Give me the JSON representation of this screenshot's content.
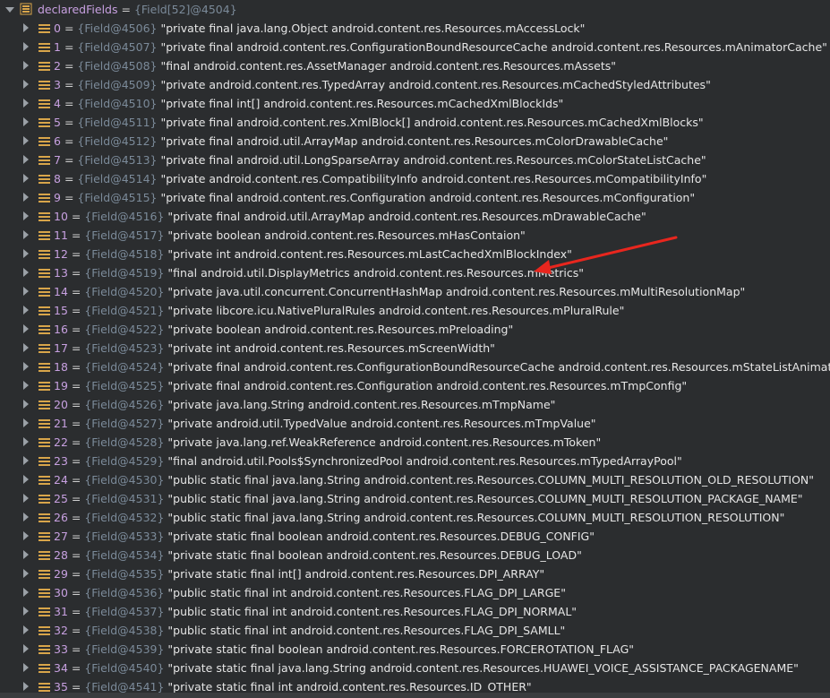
{
  "root": {
    "name": "declaredFields",
    "equals": "=",
    "ref": "{Field[52]@4504}"
  },
  "fields": [
    {
      "idx": "0",
      "ref": "{Field@4506}",
      "value": "\"private final java.lang.Object android.content.res.Resources.mAccessLock\""
    },
    {
      "idx": "1",
      "ref": "{Field@4507}",
      "value": "\"private final android.content.res.ConfigurationBoundResourceCache android.content.res.Resources.mAnimatorCache\""
    },
    {
      "idx": "2",
      "ref": "{Field@4508}",
      "value": "\"final android.content.res.AssetManager android.content.res.Resources.mAssets\""
    },
    {
      "idx": "3",
      "ref": "{Field@4509}",
      "value": "\"private android.content.res.TypedArray android.content.res.Resources.mCachedStyledAttributes\""
    },
    {
      "idx": "4",
      "ref": "{Field@4510}",
      "value": "\"private final int[] android.content.res.Resources.mCachedXmlBlockIds\""
    },
    {
      "idx": "5",
      "ref": "{Field@4511}",
      "value": "\"private final android.content.res.XmlBlock[] android.content.res.Resources.mCachedXmlBlocks\""
    },
    {
      "idx": "6",
      "ref": "{Field@4512}",
      "value": "\"private final android.util.ArrayMap android.content.res.Resources.mColorDrawableCache\""
    },
    {
      "idx": "7",
      "ref": "{Field@4513}",
      "value": "\"private final android.util.LongSparseArray android.content.res.Resources.mColorStateListCache\""
    },
    {
      "idx": "8",
      "ref": "{Field@4514}",
      "value": "\"private android.content.res.CompatibilityInfo android.content.res.Resources.mCompatibilityInfo\""
    },
    {
      "idx": "9",
      "ref": "{Field@4515}",
      "value": "\"private final android.content.res.Configuration android.content.res.Resources.mConfiguration\""
    },
    {
      "idx": "10",
      "ref": "{Field@4516}",
      "value": "\"private final android.util.ArrayMap android.content.res.Resources.mDrawableCache\""
    },
    {
      "idx": "11",
      "ref": "{Field@4517}",
      "value": "\"private boolean android.content.res.Resources.mHasContaion\""
    },
    {
      "idx": "12",
      "ref": "{Field@4518}",
      "value": "\"private int android.content.res.Resources.mLastCachedXmlBlockIndex\""
    },
    {
      "idx": "13",
      "ref": "{Field@4519}",
      "value": "\"final android.util.DisplayMetrics android.content.res.Resources.mMetrics\""
    },
    {
      "idx": "14",
      "ref": "{Field@4520}",
      "value": "\"private java.util.concurrent.ConcurrentHashMap android.content.res.Resources.mMultiResolutionMap\""
    },
    {
      "idx": "15",
      "ref": "{Field@4521}",
      "value": "\"private libcore.icu.NativePluralRules android.content.res.Resources.mPluralRule\""
    },
    {
      "idx": "16",
      "ref": "{Field@4522}",
      "value": "\"private boolean android.content.res.Resources.mPreloading\""
    },
    {
      "idx": "17",
      "ref": "{Field@4523}",
      "value": "\"private int android.content.res.Resources.mScreenWidth\""
    },
    {
      "idx": "18",
      "ref": "{Field@4524}",
      "value": "\"private final android.content.res.ConfigurationBoundResourceCache android.content.res.Resources.mStateListAnimatorCache\""
    },
    {
      "idx": "19",
      "ref": "{Field@4525}",
      "value": "\"private final android.content.res.Configuration android.content.res.Resources.mTmpConfig\""
    },
    {
      "idx": "20",
      "ref": "{Field@4526}",
      "value": "\"private java.lang.String android.content.res.Resources.mTmpName\""
    },
    {
      "idx": "21",
      "ref": "{Field@4527}",
      "value": "\"private android.util.TypedValue android.content.res.Resources.mTmpValue\""
    },
    {
      "idx": "22",
      "ref": "{Field@4528}",
      "value": "\"private java.lang.ref.WeakReference android.content.res.Resources.mToken\""
    },
    {
      "idx": "23",
      "ref": "{Field@4529}",
      "value": "\"final android.util.Pools$SynchronizedPool android.content.res.Resources.mTypedArrayPool\""
    },
    {
      "idx": "24",
      "ref": "{Field@4530}",
      "value": "\"public static final java.lang.String android.content.res.Resources.COLUMN_MULTI_RESOLUTION_OLD_RESOLUTION\""
    },
    {
      "idx": "25",
      "ref": "{Field@4531}",
      "value": "\"public static final java.lang.String android.content.res.Resources.COLUMN_MULTI_RESOLUTION_PACKAGE_NAME\""
    },
    {
      "idx": "26",
      "ref": "{Field@4532}",
      "value": "\"public static final java.lang.String android.content.res.Resources.COLUMN_MULTI_RESOLUTION_RESOLUTION\""
    },
    {
      "idx": "27",
      "ref": "{Field@4533}",
      "value": "\"private static final boolean android.content.res.Resources.DEBUG_CONFIG\""
    },
    {
      "idx": "28",
      "ref": "{Field@4534}",
      "value": "\"private static final boolean android.content.res.Resources.DEBUG_LOAD\""
    },
    {
      "idx": "29",
      "ref": "{Field@4535}",
      "value": "\"private static final int[] android.content.res.Resources.DPI_ARRAY\""
    },
    {
      "idx": "30",
      "ref": "{Field@4536}",
      "value": "\"public static final int android.content.res.Resources.FLAG_DPI_LARGE\""
    },
    {
      "idx": "31",
      "ref": "{Field@4537}",
      "value": "\"public static final int android.content.res.Resources.FLAG_DPI_NORMAL\""
    },
    {
      "idx": "32",
      "ref": "{Field@4538}",
      "value": "\"public static final int android.content.res.Resources.FLAG_DPI_SAMLL\""
    },
    {
      "idx": "33",
      "ref": "{Field@4539}",
      "value": "\"private static final boolean android.content.res.Resources.FORCEROTATION_FLAG\""
    },
    {
      "idx": "34",
      "ref": "{Field@4540}",
      "value": "\"private static final java.lang.String android.content.res.Resources.HUAWEI_VOICE_ASSISTANCE_PACKAGENAME\""
    },
    {
      "idx": "35",
      "ref": "{Field@4541}",
      "value": "\"private static final int android.content.res.Resources.ID_OTHER\""
    }
  ],
  "annotation": {
    "icon": "red-arrow-icon",
    "color": "#e8261e"
  },
  "colors": {
    "background": "#2b2d2f",
    "field_name": "#c7a0e0",
    "object_ref": "#7b8a99",
    "value": "#e6e6e6",
    "field_icon": "#d8a54a"
  }
}
